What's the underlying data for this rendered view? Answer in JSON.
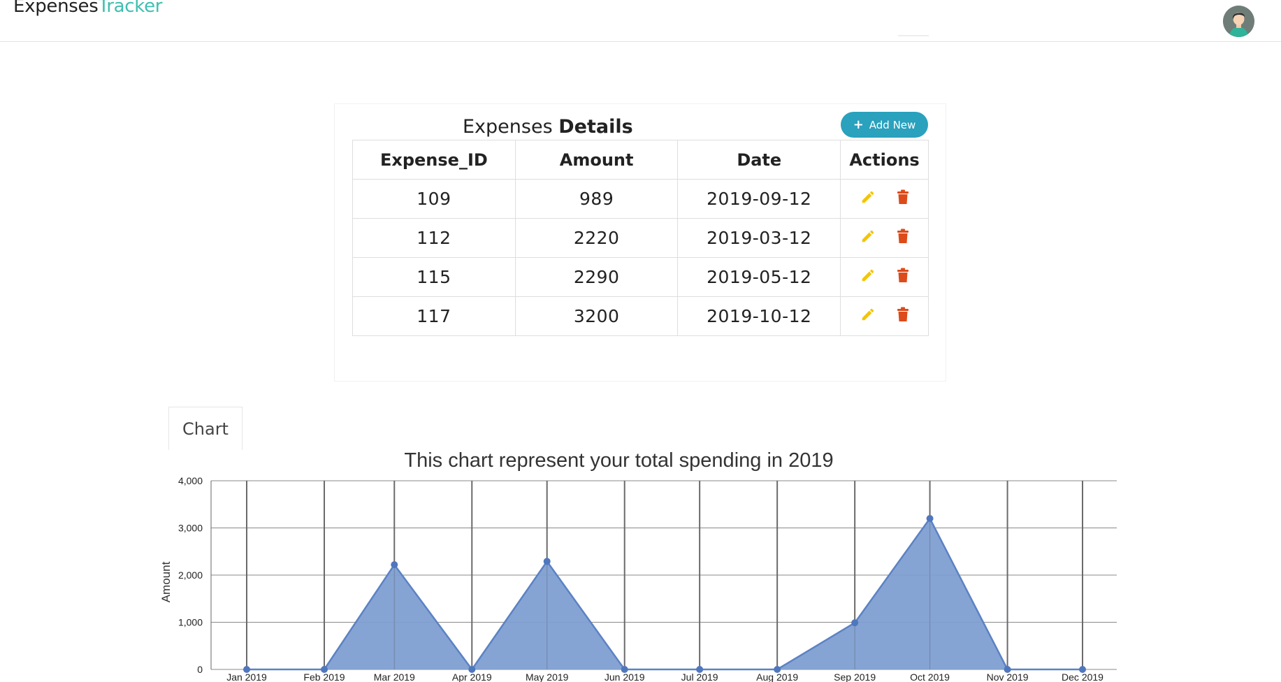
{
  "brand": {
    "part1": "Expenses",
    "part2": "Tracker"
  },
  "user": {
    "avatar_alt": "user avatar"
  },
  "panel": {
    "title_light": "Expenses",
    "title_bold": "Details",
    "add_button_label": "Add New",
    "columns": [
      "Expense_ID",
      "Amount",
      "Date",
      "Actions"
    ],
    "rows": [
      {
        "id": "109",
        "amount": "989",
        "date": "2019-09-12"
      },
      {
        "id": "112",
        "amount": "2220",
        "date": "2019-03-12"
      },
      {
        "id": "115",
        "amount": "2290",
        "date": "2019-05-12"
      },
      {
        "id": "117",
        "amount": "3200",
        "date": "2019-10-12"
      }
    ],
    "edit_icon": "pencil-icon",
    "delete_icon": "trash-icon",
    "edit_color": "#f5c400",
    "delete_color": "#dd4b1a"
  },
  "tab": {
    "label": "Chart"
  },
  "chart_data": {
    "type": "area",
    "title": "This chart represent your total spending in 2019",
    "ylabel": "Amount",
    "xlabel": "",
    "categories": [
      "Jan 2019",
      "Feb 2019",
      "Mar 2019",
      "Apr 2019",
      "May 2019",
      "Jun 2019",
      "Jul 2019",
      "Aug 2019",
      "Sep 2019",
      "Oct 2019",
      "Nov 2019",
      "Dec 2019"
    ],
    "x_dates": [
      "2019-01-01",
      "2019-02-01",
      "2019-03-01",
      "2019-04-01",
      "2019-05-01",
      "2019-06-01",
      "2019-07-01",
      "2019-08-01",
      "2019-09-01",
      "2019-10-01",
      "2019-11-01",
      "2019-12-01"
    ],
    "series": [
      {
        "x": [
          "2019-01-01",
          "2019-02-01",
          "2019-03-01",
          "2019-04-01",
          "2019-05-01",
          "2019-06-01",
          "2019-07-01",
          "2019-08-01",
          "2019-09-01",
          "2019-10-01",
          "2019-11-01",
          "2019-12-01"
        ],
        "values": [
          0,
          0,
          2220,
          0,
          2290,
          0,
          0,
          0,
          989,
          3200,
          0,
          0
        ]
      }
    ],
    "yticks": [
      "0",
      "1,000",
      "2,000",
      "3,000",
      "4,000"
    ],
    "ylim": [
      0,
      4000
    ],
    "grid": true,
    "colors": {
      "fill": "#7f9fd1",
      "line": "#5b82c4",
      "point": "#4f77bd",
      "grid": "#6b6b6b",
      "hgrid": "#8a8a8a"
    }
  }
}
